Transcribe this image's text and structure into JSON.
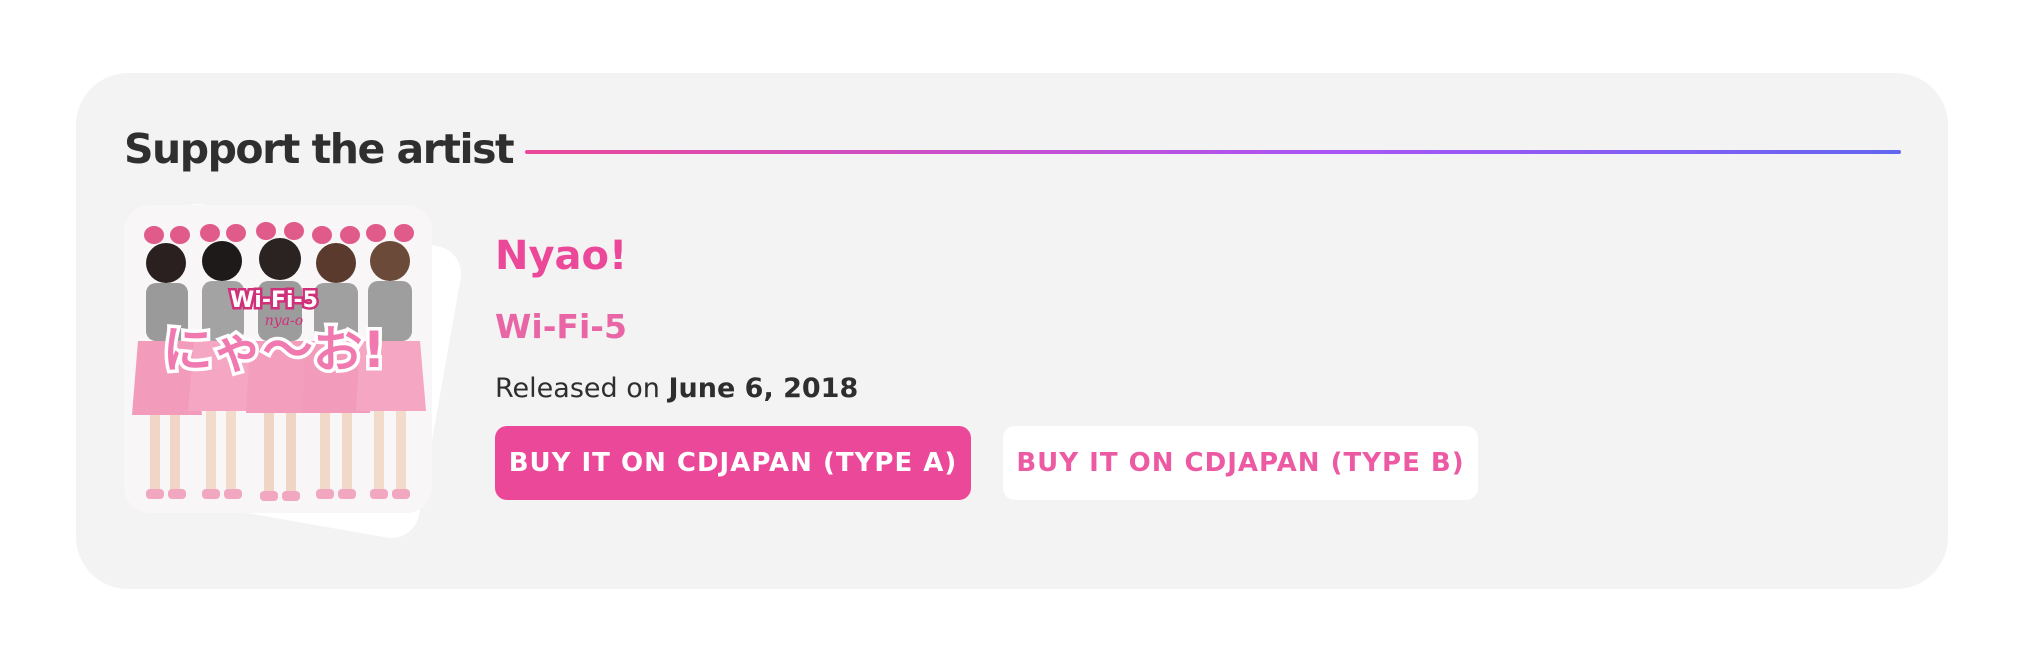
{
  "section": {
    "heading": "Support the artist"
  },
  "release": {
    "title": "Nyao!",
    "artist": "Wi-Fi-5",
    "released_prefix": "Released on",
    "released_date": "June 6, 2018"
  },
  "cover": {
    "logo_text": "Wi-Fi-5",
    "title_text": "にゃ〜お!",
    "subtitle_text": "nya-o"
  },
  "buttons": {
    "type_a": "BUY IT ON CDJAPAN (TYPE A)",
    "type_b": "BUY IT ON CDJAPAN (TYPE B)"
  },
  "colors": {
    "accent": "#ec4899",
    "accent_light": "#e866a5",
    "gradient_end": "#6366f1",
    "card_bg": "#f3f3f3"
  }
}
